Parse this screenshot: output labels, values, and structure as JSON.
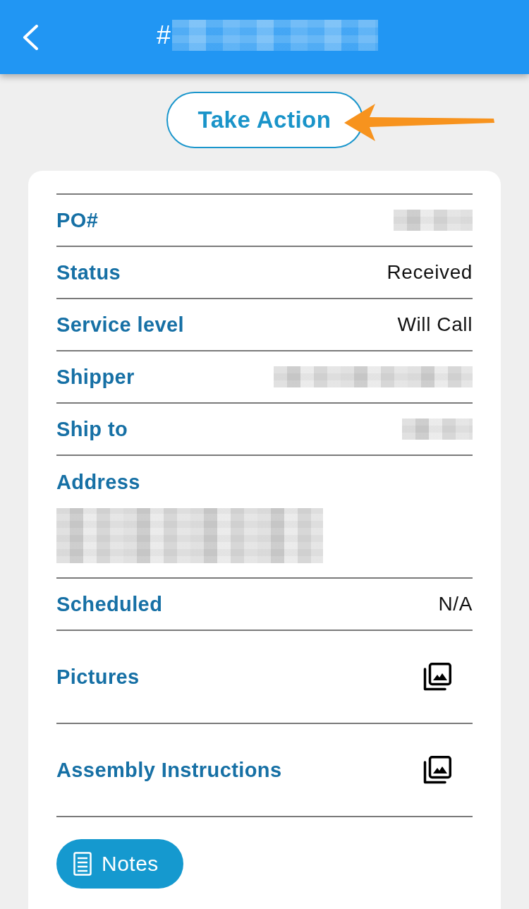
{
  "header": {
    "title": "#",
    "title_redacted": true
  },
  "take_action": {
    "label": "Take Action"
  },
  "details": [
    {
      "kind": "redacted",
      "label": "PO#"
    },
    {
      "kind": "value",
      "label": "Status",
      "value": "Received"
    },
    {
      "kind": "value",
      "label": "Service level",
      "value": "Will Call"
    },
    {
      "kind": "redacted",
      "label": "Shipper"
    },
    {
      "kind": "redacted",
      "label": "Ship to"
    },
    {
      "kind": "address",
      "label": "Address"
    },
    {
      "kind": "value",
      "label": "Scheduled",
      "value": "N/A"
    },
    {
      "kind": "media",
      "label": "Pictures"
    },
    {
      "kind": "media",
      "label": "Assembly Instructions"
    }
  ],
  "notes_button": {
    "label": "Notes"
  }
}
